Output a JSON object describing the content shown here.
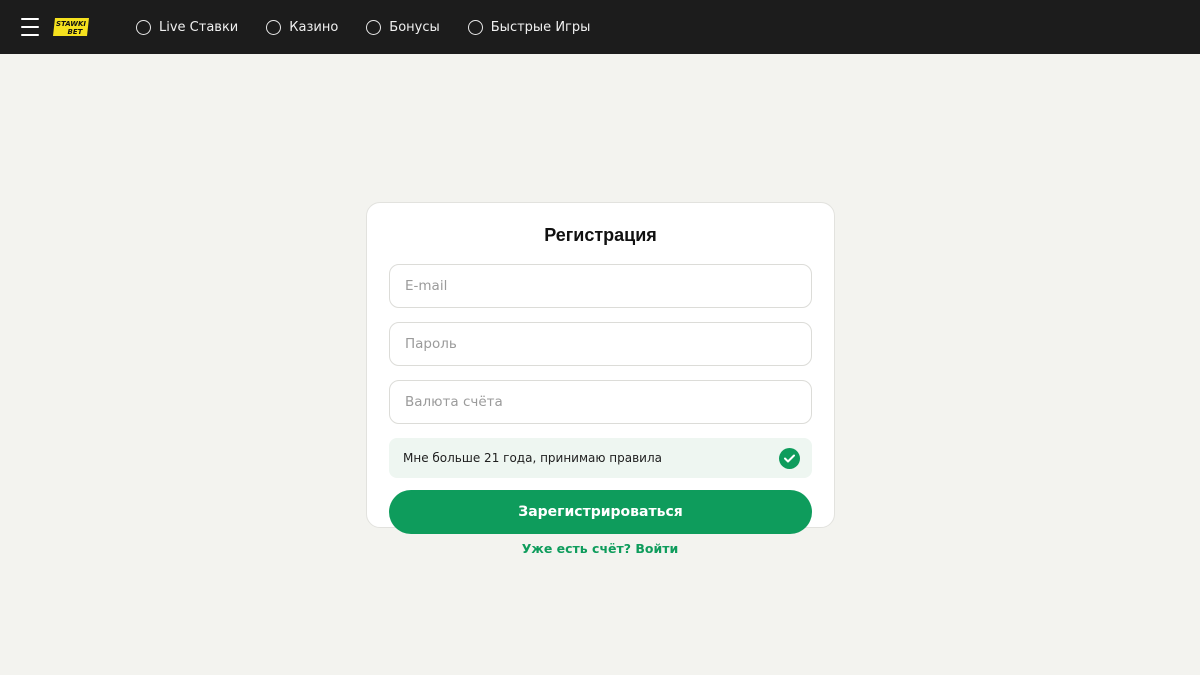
{
  "header": {
    "menu_icon": "hamburger-menu-icon",
    "logo": {
      "line1": "STAWKI",
      "line2": "BET",
      "color": "#f5e11e"
    },
    "nav": [
      {
        "label": "Live Ставки",
        "icon": "circle-icon"
      },
      {
        "label": "Казино",
        "icon": "circle-icon"
      },
      {
        "label": "Бонусы",
        "icon": "circle-icon"
      },
      {
        "label": "Быстрые Игры",
        "icon": "circle-icon"
      }
    ]
  },
  "form": {
    "title": "Регистрация",
    "email": {
      "placeholder": "E-mail",
      "value": ""
    },
    "password": {
      "placeholder": "Пароль",
      "value": ""
    },
    "currency": {
      "placeholder": "Валюта счёта",
      "value": ""
    },
    "consent": {
      "label": "Мне больше 21 года, принимаю правила",
      "checked": true
    },
    "submit_label": "Зарегистрироваться",
    "login_link": "Уже есть счёт? Войти"
  },
  "colors": {
    "accent": "#0e9c5c",
    "header_bg": "#1c1c1c",
    "page_bg": "#f3f3ef"
  }
}
